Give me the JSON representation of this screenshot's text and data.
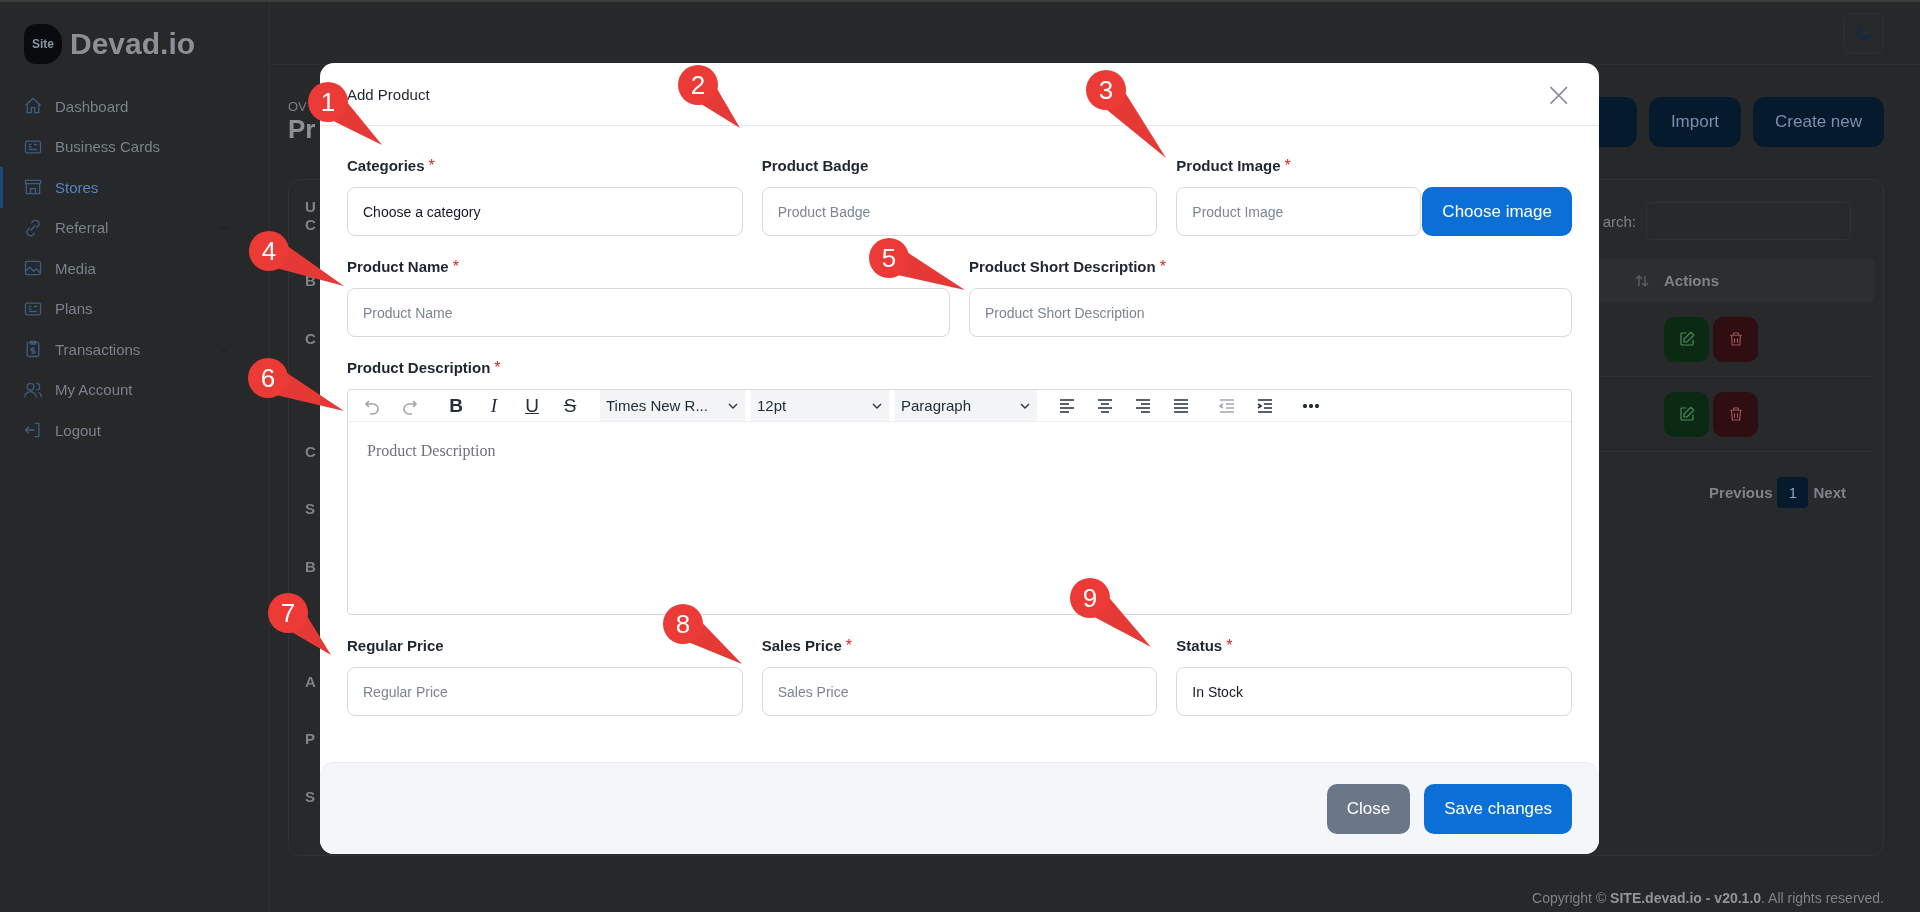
{
  "brand": {
    "badge": "Site",
    "name": "Devad.io"
  },
  "sidebar": {
    "items": [
      {
        "label": "Dashboard",
        "selected": false,
        "has_submenu": false
      },
      {
        "label": "Business Cards",
        "selected": false,
        "has_submenu": false
      },
      {
        "label": "Stores",
        "selected": true,
        "has_submenu": false
      },
      {
        "label": "Referral",
        "selected": false,
        "has_submenu": true
      },
      {
        "label": "Media",
        "selected": false,
        "has_submenu": false
      },
      {
        "label": "Plans",
        "selected": false,
        "has_submenu": false
      },
      {
        "label": "Transactions",
        "selected": false,
        "has_submenu": true
      },
      {
        "label": "My Account",
        "selected": false,
        "has_submenu": false
      },
      {
        "label": "Logout",
        "selected": false,
        "has_submenu": false
      }
    ]
  },
  "page": {
    "overline": "OV",
    "title": "Pr",
    "buttons": [
      "Import",
      "Create new"
    ],
    "search_label": "arch:",
    "row_fragments": [
      "U",
      "C",
      "B",
      "C",
      "C",
      "S",
      "B",
      "A",
      "P",
      "S"
    ],
    "table": {
      "columns": [
        {
          "sortable": true
        },
        {
          "label": "Actions",
          "sortable": false
        }
      ],
      "rows": [
        {
          "kind": "actions"
        },
        {
          "kind": "actions"
        }
      ]
    },
    "pagination": {
      "previous": "Previous",
      "pages": [
        {
          "label": "1",
          "selected": true
        }
      ],
      "next": "Next"
    },
    "footer": {
      "prefix": "Copyright © ",
      "brand": "SITE.devad.io - v20.1.0",
      "suffix": ". All rights reserved."
    }
  },
  "modal": {
    "title": "Add Product",
    "close": "×",
    "rows": [
      [
        {
          "label": "Categories",
          "required_mark": "*",
          "kind": "select",
          "value": "Choose a category"
        },
        {
          "label": "Product Badge",
          "kind": "input",
          "placeholder": "Product Badge"
        },
        {
          "label": "Product Image",
          "required_mark": "*",
          "kind": "file",
          "placeholder": "Product Image",
          "button": "Choose image"
        }
      ],
      [
        {
          "label": "Product Name",
          "required_mark": "*",
          "kind": "input",
          "placeholder": "Product Name"
        },
        {
          "label": "Product Short Description",
          "required_mark": "*",
          "kind": "input",
          "placeholder": "Product Short Description"
        }
      ]
    ],
    "description": {
      "label": "Product Description",
      "required_mark": "*",
      "placeholder": "Product Description",
      "toolbar": [
        [
          {
            "kind": "undo",
            "disabled": true
          },
          {
            "kind": "redo",
            "disabled": true
          }
        ],
        [
          {
            "kind": "bold",
            "text": "B",
            "disabled": false
          },
          {
            "kind": "italic",
            "text": "I",
            "disabled": false
          },
          {
            "kind": "underline",
            "text": "U",
            "disabled": false
          },
          {
            "kind": "strike",
            "text": "S",
            "disabled": false
          }
        ],
        [
          {
            "kind": "select",
            "value": "Times New R...",
            "disabled": false
          },
          {
            "kind": "select",
            "value": "12pt",
            "disabled": false
          },
          {
            "kind": "select",
            "value": "Paragraph",
            "disabled": false
          }
        ],
        [
          {
            "kind": "align-left",
            "disabled": false
          },
          {
            "kind": "align-center",
            "disabled": false
          },
          {
            "kind": "align-right",
            "disabled": false
          },
          {
            "kind": "justify",
            "disabled": false
          }
        ],
        [
          {
            "kind": "outdent",
            "disabled": true
          },
          {
            "kind": "indent",
            "disabled": false
          }
        ],
        [
          {
            "kind": "more",
            "disabled": false
          }
        ]
      ]
    },
    "price_row": [
      {
        "label": "Regular Price",
        "kind": "input",
        "placeholder": "Regular Price"
      },
      {
        "label": "Sales Price",
        "required_mark": "*",
        "kind": "input",
        "placeholder": "Sales Price"
      },
      {
        "label": "Status",
        "required_mark": "*",
        "kind": "select",
        "value": "In Stock"
      }
    ],
    "footer_buttons": [
      {
        "label": "Close",
        "kind": "secondary"
      },
      {
        "label": "Save changes",
        "kind": "primary"
      }
    ]
  },
  "callouts": [
    "1",
    "2",
    "3",
    "4",
    "5",
    "6",
    "7",
    "8",
    "9"
  ]
}
